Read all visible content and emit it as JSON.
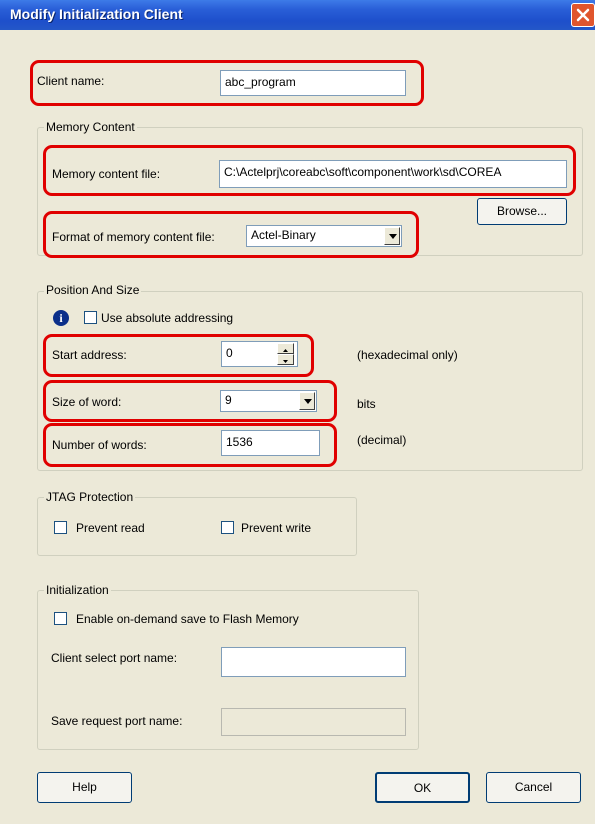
{
  "window": {
    "title": "Modify Initialization Client"
  },
  "client_name": {
    "label": "Client name:",
    "value": "abc_program"
  },
  "memory_content": {
    "group_label": "Memory Content",
    "file_label": "Memory content file:",
    "file_value": "C:\\Actelprj\\coreabc\\soft\\component\\work\\sd\\COREA",
    "browse_label": "Browse...",
    "format_label": "Format of memory content file:",
    "format_value": "Actel-Binary"
  },
  "position_size": {
    "group_label": "Position And Size",
    "absolute_label": "Use absolute addressing",
    "absolute_checked": false,
    "start_label": "Start address:",
    "start_value": "0",
    "start_note": "(hexadecimal only)",
    "word_size_label": "Size of word:",
    "word_size_value": "9",
    "word_size_unit": "bits",
    "num_words_label": "Number of words:",
    "num_words_value": "1536",
    "num_words_note": "(decimal)"
  },
  "jtag": {
    "group_label": "JTAG Protection",
    "prevent_read_label": "Prevent read",
    "prevent_read_checked": false,
    "prevent_write_label": "Prevent write",
    "prevent_write_checked": false
  },
  "initialization": {
    "group_label": "Initialization",
    "enable_label": "Enable on-demand save to Flash Memory",
    "enable_checked": false,
    "client_port_label": "Client select port name:",
    "client_port_value": "",
    "save_port_label": "Save request port name:",
    "save_port_value": ""
  },
  "buttons": {
    "help": "Help",
    "ok": "OK",
    "cancel": "Cancel"
  },
  "colors": {
    "dialog_bg": "#ECE9D8",
    "titlebar": "#2A5FD8",
    "highlight": "#E00000"
  },
  "icons": {
    "close": "close-icon",
    "info": "info-icon",
    "dropdown": "chevron-down-icon"
  }
}
